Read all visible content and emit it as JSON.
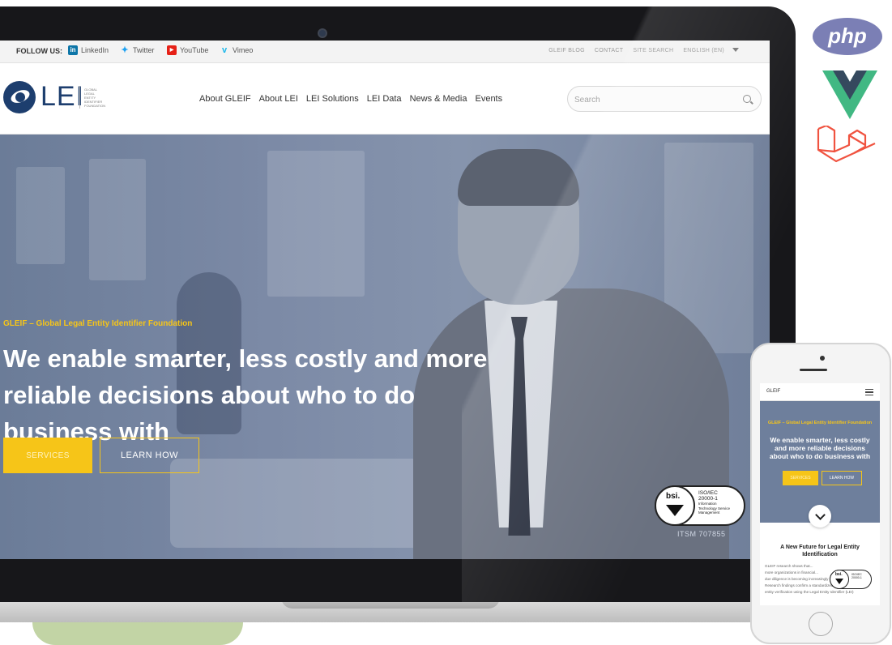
{
  "utility_bar": {
    "follow_label": "FOLLOW US:",
    "social": [
      {
        "label": "LinkedIn",
        "icon": "linkedin-icon",
        "color": "#0e76a8"
      },
      {
        "label": "Twitter",
        "icon": "twitter-icon",
        "color": "#1da1f2"
      },
      {
        "label": "YouTube",
        "icon": "youtube-icon",
        "color": "#e62117"
      },
      {
        "label": "Vimeo",
        "icon": "vimeo-icon",
        "color": "#1ab7ea"
      }
    ],
    "links": [
      "GLEIF BLOG",
      "CONTACT",
      "SITE SEARCH",
      "ENGLISH (EN)"
    ]
  },
  "header": {
    "logo_text": "LEI",
    "logo_sub": [
      "GLOBAL",
      "LEGAL",
      "ENTITY",
      "IDENTIFIER",
      "FOUNDATION"
    ],
    "nav": [
      "About GLEIF",
      "About LEI",
      "LEI Solutions",
      "LEI Data",
      "News & Media",
      "Events"
    ],
    "search_placeholder": "Search"
  },
  "hero": {
    "kicker": "GLEIF – Global Legal Entity Identifier Foundation",
    "title": "We enable smarter, less costly and more reliable decisions about who to do business with",
    "services_label": "SERVICES",
    "learn_label": "LEARN HOW"
  },
  "badge": {
    "brand": "bsi.",
    "standard": [
      "ISO/IEC",
      "20000-1",
      "Information",
      "Technology Service",
      "Management"
    ],
    "code": "ITSM 707855"
  },
  "tech": {
    "php": "php"
  },
  "mobile": {
    "brand": "GLEIF",
    "kicker": "GLEIF – Global Legal Entity Identifier Foundation",
    "title": "We enable smarter, less costly and more reliable decisions about who to do business with",
    "services_label": "SERVICES",
    "learn_label": "LEARN HOW",
    "section_title": "A New Future for Legal Entity Identification",
    "body_lines": [
      "GLEIF research shows that...",
      "more organizations in financial...",
      "due diligence is becoming increasingly complex.",
      "Research findings confirm a standardized approach to",
      "entity verification using the Legal Entity Identifier (LEI)"
    ]
  },
  "colors": {
    "accent_yellow": "#f6c518",
    "brand_blue": "#1d3e6e",
    "hero_overlay": "#7c8aa6"
  }
}
